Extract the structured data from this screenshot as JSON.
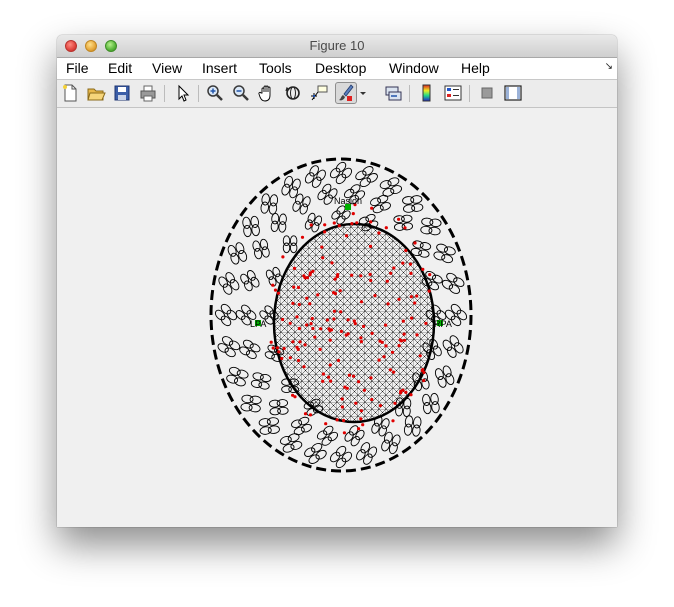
{
  "window": {
    "title": "Figure 10",
    "controls": [
      "close",
      "minimize",
      "zoom"
    ]
  },
  "menubar": {
    "items": [
      {
        "label": "File"
      },
      {
        "label": "Edit"
      },
      {
        "label": "View"
      },
      {
        "label": "Insert"
      },
      {
        "label": "Tools"
      },
      {
        "label": "Desktop"
      },
      {
        "label": "Window"
      },
      {
        "label": "Help"
      }
    ]
  },
  "toolbar": {
    "tools": [
      "new-figure-icon",
      "open-file-icon",
      "save-icon",
      "print-icon",
      "edit-plot-arrow-icon",
      "zoom-in-icon",
      "zoom-out-icon",
      "pan-hand-icon",
      "rotate-3d-icon",
      "data-cursor-icon",
      "brush-icon",
      "brush-dropdown-icon",
      "link-plot-icon",
      "colorbar-icon",
      "legend-icon",
      "hide-plot-tools-icon",
      "show-plot-tools-icon"
    ],
    "pressed_tool": "brush-icon"
  },
  "figure": {
    "labels": {
      "nasion": "Nasion",
      "lpa": "LPA",
      "rpa": "RPA"
    },
    "colors": {
      "mesh": "#000000",
      "electrodes": "#e00000",
      "fiducials": "#00b000",
      "background": "#f0f0f0"
    }
  }
}
